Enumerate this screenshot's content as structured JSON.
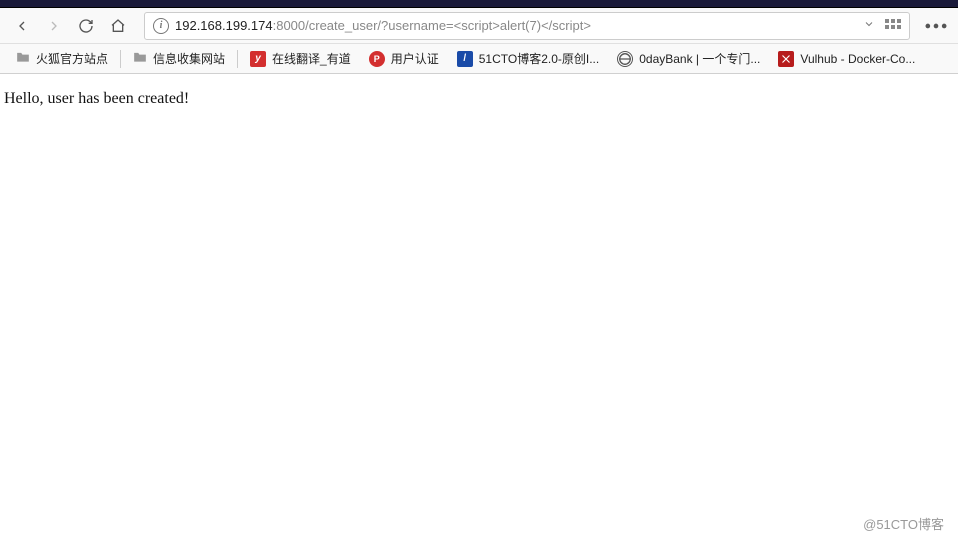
{
  "url": {
    "host": "192.168.199.174",
    "rest": ":8000/create_user/?username=<script>alert(7)</script>"
  },
  "bookmarks": {
    "folder1": "火狐官方站点",
    "folder2": "信息收集网站",
    "youdao": "在线翻译_有道",
    "userauth": "用户认证",
    "cto": "51CTO博客2.0-原创I...",
    "oday": "0dayBank | 一个专门...",
    "vulhub": "Vulhub - Docker-Co..."
  },
  "page": {
    "message": "Hello, user has been created!"
  },
  "watermark": "@51CTO博客",
  "icons": {
    "info": "i",
    "youdao": "y",
    "user": "P",
    "cto": "/",
    "oday": "⊙"
  }
}
